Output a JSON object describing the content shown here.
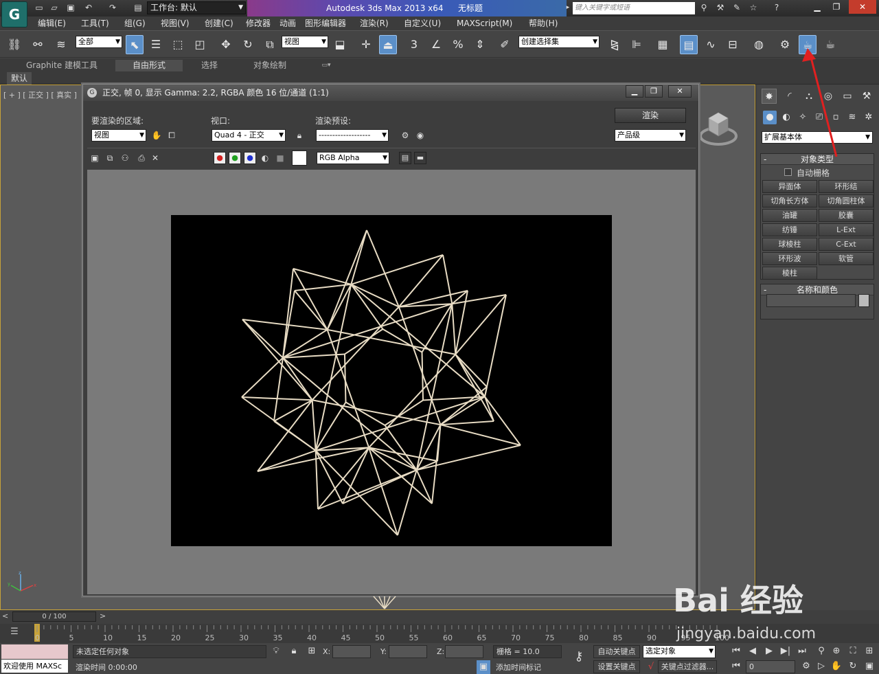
{
  "titlebar": {
    "workspace": "工作台: 默认",
    "app_title": "Autodesk 3ds Max  2013 x64",
    "doc_title": "无标题",
    "search_placeholder": "键入关键字或短语"
  },
  "menu": [
    "编辑(E)",
    "工具(T)",
    "组(G)",
    "视图(V)",
    "创建(C)",
    "修改器",
    "动画",
    "图形编辑器",
    "渲染(R)",
    "自定义(U)",
    "MAXScript(M)",
    "帮助(H)"
  ],
  "toolbar": {
    "selection_filter": "全部",
    "ref_coord": "视图",
    "named_selection": "创建选择集",
    "snap_3": "3",
    "snap_percent": "%"
  },
  "ribbon": {
    "tabs": [
      "Graphite 建模工具",
      "自由形式",
      "选择",
      "对象绘制"
    ],
    "default_tab": "默认"
  },
  "viewport": {
    "label": "[ + ] [ 正交 ] [ 真实 ]"
  },
  "render_window": {
    "title": "正交, 帧 0, 显示 Gamma: 2.2, RGBA 颜色 16 位/通道 (1:1)",
    "area_label": "要渲染的区域:",
    "area_value": "视图",
    "viewport_label": "视口:",
    "viewport_value": "Quad 4 - 正交",
    "preset_label": "渲染预设:",
    "preset_value": "-------------------",
    "render_button": "渲染",
    "quality_value": "产品级",
    "channel_value": "RGB Alpha"
  },
  "command_panel": {
    "category": "扩展基本体",
    "object_type_header": "对象类型",
    "autogrid_label": "自动栅格",
    "objects": [
      "异面体",
      "环形结",
      "切角长方体",
      "切角圆柱体",
      "油罐",
      "胶囊",
      "纺锤",
      "L-Ext",
      "球棱柱",
      "C-Ext",
      "环形波",
      "软管",
      "棱柱"
    ],
    "name_color_header": "名称和颜色"
  },
  "timeline": {
    "slider": "0 / 100",
    "ticks": [
      "0",
      "5",
      "10",
      "15",
      "20",
      "25",
      "30",
      "35",
      "40",
      "45",
      "50",
      "55",
      "60",
      "65",
      "70",
      "75",
      "80",
      "85",
      "90",
      "95",
      "100"
    ]
  },
  "status": {
    "welcome": "欢迎使用 MAXSc",
    "selection": "未选定任何对象",
    "render_time": "渲染时间  0:00:00",
    "x_label": "X:",
    "y_label": "Y:",
    "z_label": "Z:",
    "grid": "栅格 = 10.0",
    "add_time_tag": "添加时间标记",
    "auto_key": "自动关键点",
    "set_key": "设置关键点",
    "selected_object": "选定对象",
    "key_filters": "关键点过滤器...",
    "frame": "0"
  },
  "watermark": {
    "brand": "Bai 经验",
    "url": "jingyan.baidu.com"
  },
  "colors": {
    "accent": "#5b8fc8",
    "annotation_arrow": "#e02020",
    "wireframe": "#e8dcc4"
  },
  "icons": {
    "app_logo": "3dsmax-logo-icon",
    "render_setup": "teapot-render-icon",
    "arrow": "annotation-arrow"
  }
}
